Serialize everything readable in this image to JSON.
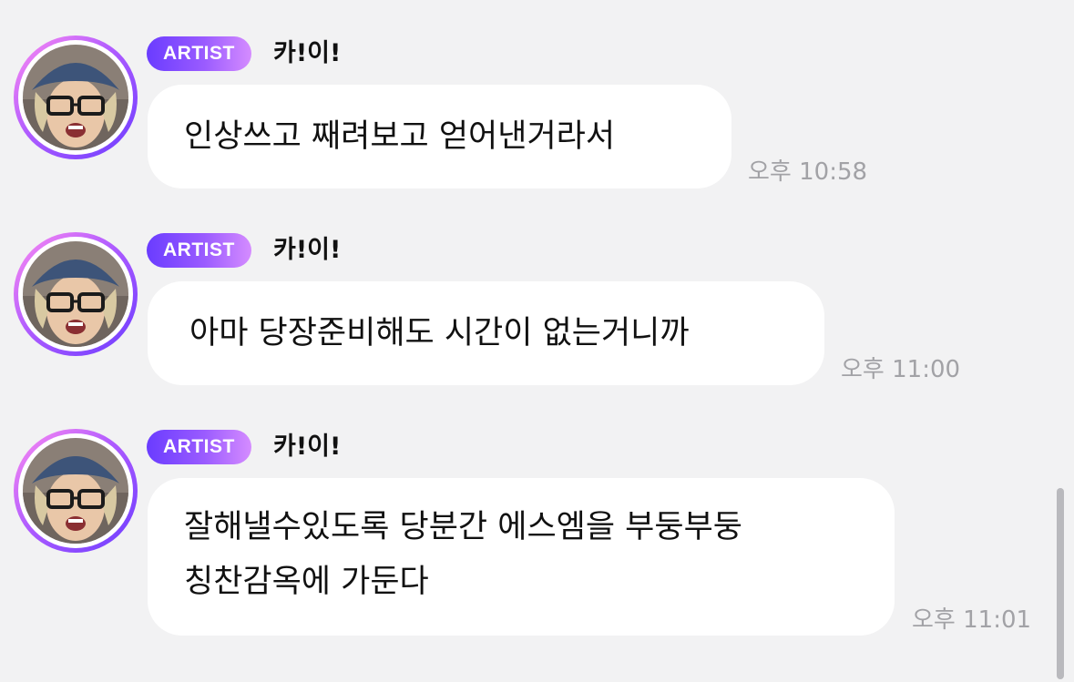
{
  "messages": [
    {
      "badge": "ARTIST",
      "sender": "카!이!",
      "lines": [
        "인상쓰고 째려보고 얻어낸거라서"
      ],
      "time": "오후 10:58"
    },
    {
      "badge": "ARTIST",
      "sender": "카!이!",
      "lines": [
        "아마 당장준비해도 시간이 없는거니까"
      ],
      "time": "오후 11:00"
    },
    {
      "badge": "ARTIST",
      "sender": "카!이!",
      "lines": [
        "잘해낼수있도록 당분간 에스엠을 부둥부둥",
        "칭찬감옥에 가둔다"
      ],
      "time": "오후 11:01"
    }
  ],
  "icons": {
    "avatar": "artist-avatar-icon"
  },
  "colors": {
    "background": "#f2f2f3",
    "bubble": "#ffffff",
    "badge_start": "#6a3cff",
    "badge_end": "#d58cff",
    "time_text": "#a2a2a6"
  }
}
